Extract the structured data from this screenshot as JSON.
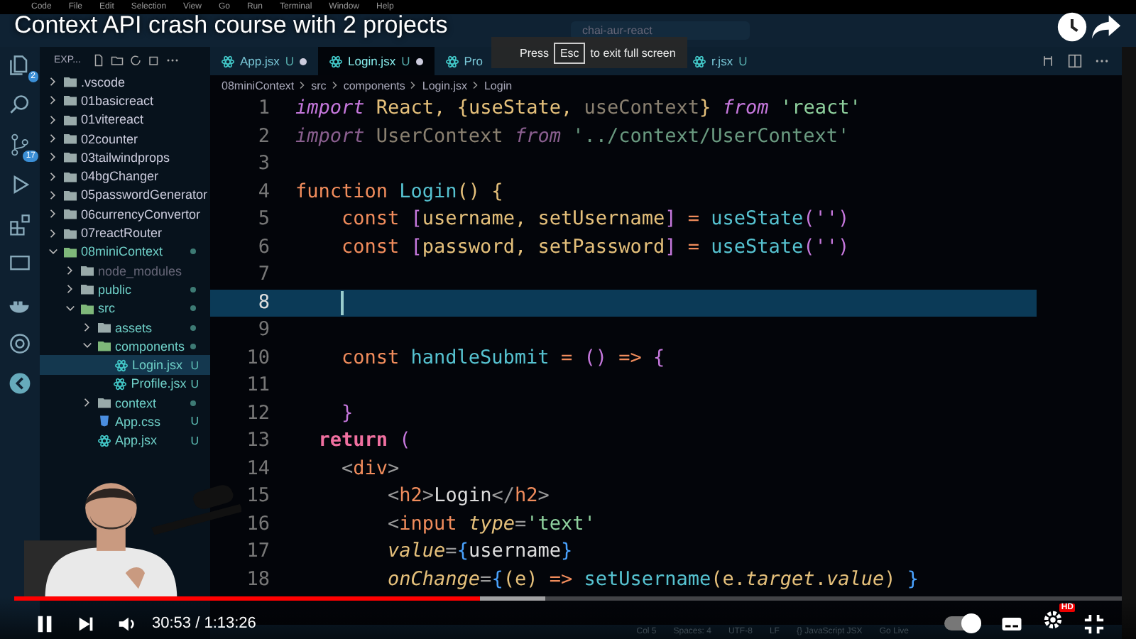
{
  "menubar": [
    "Code",
    "File",
    "Edit",
    "Selection",
    "View",
    "Go",
    "Run",
    "Terminal",
    "Window",
    "Help"
  ],
  "video_title": "Context API crash course with 2 projects",
  "command_center": "chai-aur-react",
  "activity_bar": {
    "badges": [
      "2",
      "17"
    ]
  },
  "explorer": {
    "title": "EXP...",
    "items": [
      {
        "name": ".vscode",
        "kind": "folder",
        "expanded": false
      },
      {
        "name": "01basicreact",
        "kind": "folder",
        "expanded": false
      },
      {
        "name": "01vitereact",
        "kind": "folder",
        "expanded": false
      },
      {
        "name": "02counter",
        "kind": "folder",
        "expanded": false
      },
      {
        "name": "03tailwindprops",
        "kind": "folder",
        "expanded": false
      },
      {
        "name": "04bgChanger",
        "kind": "folder",
        "expanded": false
      },
      {
        "name": "05passwordGenerator",
        "kind": "folder",
        "expanded": false
      },
      {
        "name": "06currencyConvertor",
        "kind": "folder",
        "expanded": false
      },
      {
        "name": "07reactRouter",
        "kind": "folder",
        "expanded": false
      },
      {
        "name": "08miniContext",
        "kind": "folder",
        "expanded": true,
        "modified": true,
        "children": [
          {
            "name": "node_modules",
            "kind": "folder",
            "expanded": false,
            "ignored": true
          },
          {
            "name": "public",
            "kind": "folder",
            "expanded": false,
            "modified": true
          },
          {
            "name": "src",
            "kind": "folder",
            "expanded": true,
            "modified": true,
            "children": [
              {
                "name": "assets",
                "kind": "folder",
                "expanded": false,
                "modified": true
              },
              {
                "name": "components",
                "kind": "folder",
                "expanded": true,
                "modified": true,
                "children": [
                  {
                    "name": "Login.jsx",
                    "kind": "react",
                    "status": "U",
                    "selected": true
                  },
                  {
                    "name": "Profile.jsx",
                    "kind": "react",
                    "status": "U",
                    "selected": false
                  }
                ]
              },
              {
                "name": "context",
                "kind": "folder",
                "expanded": false,
                "modified": true
              },
              {
                "name": "App.css",
                "kind": "css",
                "status": "U",
                "selected": false
              },
              {
                "name": "App.jsx",
                "kind": "react",
                "status": "U",
                "selected": false
              }
            ]
          }
        ]
      }
    ]
  },
  "tabs": [
    {
      "label": "App.jsx",
      "status": "U",
      "selected": false
    },
    {
      "label": "Login.jsx",
      "status": "U",
      "selected": true
    },
    {
      "label": "Pro",
      "selected": false
    },
    {
      "label": "r.jsx",
      "status": "U",
      "selected": false
    }
  ],
  "toast": {
    "before": "Press",
    "key": "Esc",
    "after": "to exit full screen"
  },
  "breadcrumbs": [
    "08miniContext",
    "src",
    "components",
    "Login.jsx",
    "Login"
  ],
  "code": [
    {
      "n": "1",
      "tokens": [
        {
          "kind": "kw",
          "text": "import"
        },
        {
          "kind": "id",
          "text": " React, "
        },
        {
          "kind": "brace",
          "text": "{"
        },
        {
          "kind": "id",
          "text": "useState, "
        },
        {
          "kind": "dim",
          "text": "useContext"
        },
        {
          "kind": "brace",
          "text": "}"
        },
        {
          "kind": "kw",
          "text": " from "
        },
        {
          "kind": "str",
          "text": "'react'"
        }
      ]
    },
    {
      "n": "2",
      "tokens": [
        {
          "kind": "dimkw",
          "text": "import"
        },
        {
          "kind": "dim",
          "text": " UserContext "
        },
        {
          "kind": "dimkw",
          "text": "from"
        },
        {
          "kind": "dimstr",
          "text": " '../context/UserContext'"
        }
      ]
    },
    {
      "n": "3"
    },
    {
      "n": "4",
      "tokens": [
        {
          "kind": "decl",
          "text": "function "
        },
        {
          "kind": "fn",
          "text": "Login"
        },
        {
          "kind": "brace",
          "text": "() {"
        }
      ]
    },
    {
      "n": "5",
      "tokens": [
        {
          "kind": "decl",
          "text": "    const "
        },
        {
          "kind": "pur",
          "text": "["
        },
        {
          "kind": "id",
          "text": "username, setUsername"
        },
        {
          "kind": "pur",
          "text": "]"
        },
        {
          "kind": "decl",
          "text": " = "
        },
        {
          "kind": "fn",
          "text": "useState"
        },
        {
          "kind": "pur",
          "text": "('')"
        }
      ]
    },
    {
      "n": "6",
      "tokens": [
        {
          "kind": "decl",
          "text": "    const "
        },
        {
          "kind": "pur",
          "text": "["
        },
        {
          "kind": "id",
          "text": "password, setPassword"
        },
        {
          "kind": "pur",
          "text": "]"
        },
        {
          "kind": "decl",
          "text": " = "
        },
        {
          "kind": "fn",
          "text": "useState"
        },
        {
          "kind": "pur",
          "text": "('')"
        }
      ]
    },
    {
      "n": "7"
    },
    {
      "n": "8",
      "current": true
    },
    {
      "n": "9"
    },
    {
      "n": "10",
      "tokens": [
        {
          "kind": "decl",
          "text": "    const "
        },
        {
          "kind": "fn",
          "text": "handleSubmit"
        },
        {
          "kind": "decl",
          "text": " = "
        },
        {
          "kind": "pur",
          "text": "() "
        },
        {
          "kind": "decl",
          "text": "=> "
        },
        {
          "kind": "pur",
          "text": "{"
        }
      ]
    },
    {
      "n": "11"
    },
    {
      "n": "12",
      "tokens": [
        {
          "kind": "pur",
          "text": "    }"
        }
      ]
    },
    {
      "n": "13",
      "tokens": [
        {
          "kind": "ret",
          "text": "  return "
        },
        {
          "kind": "pur",
          "text": "("
        }
      ]
    },
    {
      "n": "14",
      "tokens": [
        {
          "kind": "punct",
          "text": "    <"
        },
        {
          "kind": "tag",
          "text": "div"
        },
        {
          "kind": "punct",
          "text": ">"
        }
      ]
    },
    {
      "n": "15",
      "tokens": [
        {
          "kind": "punct",
          "text": "        <"
        },
        {
          "kind": "tag",
          "text": "h2"
        },
        {
          "kind": "punct",
          "text": ">"
        },
        {
          "kind": "plain",
          "text": "Login"
        },
        {
          "kind": "punct",
          "text": "</"
        },
        {
          "kind": "tag",
          "text": "h2"
        },
        {
          "kind": "punct",
          "text": ">"
        }
      ]
    },
    {
      "n": "16",
      "tokens": [
        {
          "kind": "punct",
          "text": "        <"
        },
        {
          "kind": "tag",
          "text": "input "
        },
        {
          "kind": "attr",
          "text": "type"
        },
        {
          "kind": "punct",
          "text": "="
        },
        {
          "kind": "str",
          "text": "'text'"
        }
      ]
    },
    {
      "n": "17",
      "tokens": [
        {
          "kind": "attr",
          "text": "        value"
        },
        {
          "kind": "punct",
          "text": "="
        },
        {
          "kind": "blue",
          "text": "{"
        },
        {
          "kind": "plain",
          "text": "username"
        },
        {
          "kind": "blue",
          "text": "}"
        }
      ]
    },
    {
      "n": "18",
      "tokens": [
        {
          "kind": "attr",
          "text": "        onChange"
        },
        {
          "kind": "punct",
          "text": "="
        },
        {
          "kind": "blue",
          "text": "{"
        },
        {
          "kind": "brace",
          "text": "(e) "
        },
        {
          "kind": "decl",
          "text": "=> "
        },
        {
          "kind": "fn",
          "text": "setUsername"
        },
        {
          "kind": "brace",
          "text": "(e."
        },
        {
          "kind": "attr",
          "text": "target"
        },
        {
          "kind": "brace",
          "text": "."
        },
        {
          "kind": "attr",
          "text": "value"
        },
        {
          "kind": "brace",
          "text": ") "
        },
        {
          "kind": "blue",
          "text": "}"
        }
      ]
    }
  ],
  "status_bar": [
    "Col 5",
    "Spaces: 4",
    "UTF-8",
    "LF",
    "{} JavaScript JSX",
    "Go Live"
  ],
  "player": {
    "progress": {
      "level": 0.42
    },
    "buffered": {
      "level": 0.48
    },
    "time": "30:53 / 1:13:26",
    "playing": true,
    "autoplay": true,
    "quality_badge": "HD"
  }
}
